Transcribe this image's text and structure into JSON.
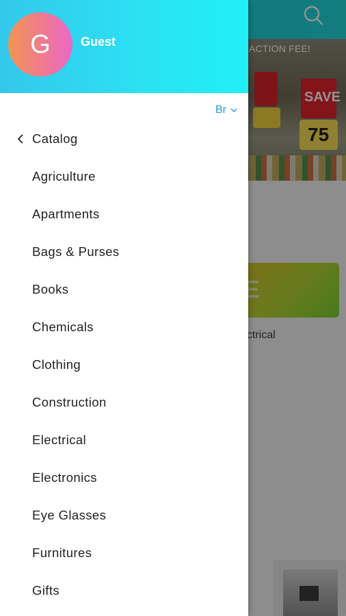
{
  "background": {
    "banner_text": "ACTION FEE!",
    "sign_save": "SAVE",
    "sign_price": "75",
    "category_peek": "ectrical",
    "promo_letter": "E"
  },
  "drawer": {
    "avatar_initial": "G",
    "user_name": "Guest",
    "language": "Br",
    "back_label": "Catalog",
    "categories": [
      "Agriculture",
      "Apartments",
      "Bags & Purses",
      "Books",
      "Chemicals",
      "Clothing",
      "Construction",
      "Electrical",
      "Electronics",
      "Eye Glasses",
      "Furnitures",
      "Gifts"
    ]
  },
  "colors": {
    "header_gradient_start": "#34c8ec",
    "header_gradient_end": "#1ff0f6",
    "accent_blue": "#1e9fd8",
    "avatar_start": "#f19552",
    "avatar_end": "#ea68c9"
  },
  "icons": {
    "search": "search-icon",
    "back": "chevron-left-icon",
    "language_dropdown": "chevron-down-icon"
  }
}
